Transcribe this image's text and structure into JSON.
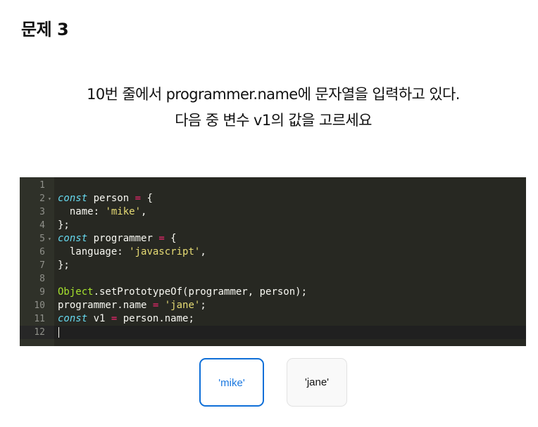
{
  "page": {
    "title": "문제 3",
    "question_line1": "10번 줄에서 programmer.name에 문자열을 입력하고 있다.",
    "question_line2": "다음 중 변수 v1의 값을 고르세요"
  },
  "editor": {
    "theme_colors": {
      "background": "#272822",
      "gutter": "#2f3129",
      "keyword": "#66d9ef",
      "operator": "#f92672",
      "string": "#e6db74",
      "object": "#a6e22e",
      "text": "#f8f8f2"
    },
    "active_line": 12,
    "lines": [
      {
        "no": "1",
        "fold": false,
        "tokens": []
      },
      {
        "no": "2",
        "fold": true,
        "tokens": [
          {
            "t": "const",
            "c": "kw"
          },
          {
            "t": " person ",
            "c": ""
          },
          {
            "t": "=",
            "c": "op"
          },
          {
            "t": " {",
            "c": ""
          }
        ]
      },
      {
        "no": "3",
        "fold": false,
        "tokens": [
          {
            "t": "  name: ",
            "c": ""
          },
          {
            "t": "'mike'",
            "c": "str"
          },
          {
            "t": ",",
            "c": ""
          }
        ]
      },
      {
        "no": "4",
        "fold": false,
        "tokens": [
          {
            "t": "};",
            "c": ""
          }
        ]
      },
      {
        "no": "5",
        "fold": true,
        "tokens": [
          {
            "t": "const",
            "c": "kw"
          },
          {
            "t": " programmer ",
            "c": ""
          },
          {
            "t": "=",
            "c": "op"
          },
          {
            "t": " {",
            "c": ""
          }
        ]
      },
      {
        "no": "6",
        "fold": false,
        "tokens": [
          {
            "t": "  language: ",
            "c": ""
          },
          {
            "t": "'javascript'",
            "c": "str"
          },
          {
            "t": ",",
            "c": ""
          }
        ]
      },
      {
        "no": "7",
        "fold": false,
        "tokens": [
          {
            "t": "};",
            "c": ""
          }
        ]
      },
      {
        "no": "8",
        "fold": false,
        "tokens": []
      },
      {
        "no": "9",
        "fold": false,
        "tokens": [
          {
            "t": "Object",
            "c": "obj"
          },
          {
            "t": ".setPrototypeOf(programmer, person);",
            "c": ""
          }
        ]
      },
      {
        "no": "10",
        "fold": false,
        "tokens": [
          {
            "t": "programmer.name ",
            "c": ""
          },
          {
            "t": "=",
            "c": "op"
          },
          {
            "t": " ",
            "c": ""
          },
          {
            "t": "'jane'",
            "c": "str"
          },
          {
            "t": ";",
            "c": ""
          }
        ]
      },
      {
        "no": "11",
        "fold": false,
        "tokens": [
          {
            "t": "const",
            "c": "kw"
          },
          {
            "t": " v1 ",
            "c": ""
          },
          {
            "t": "=",
            "c": "op"
          },
          {
            "t": " person.name;",
            "c": ""
          }
        ]
      },
      {
        "no": "12",
        "fold": false,
        "tokens": []
      }
    ]
  },
  "choices": [
    {
      "label": "'mike'",
      "selected": true
    },
    {
      "label": "'jane'",
      "selected": false
    }
  ]
}
